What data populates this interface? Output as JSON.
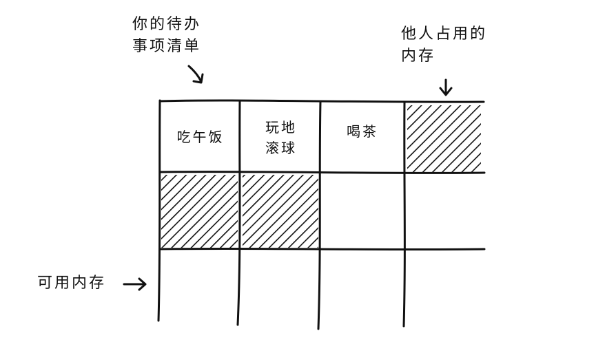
{
  "annotations": {
    "todo_list": {
      "line1": "你的待办",
      "line2": "事项清单"
    },
    "others_memory": {
      "line1": "他人占用的",
      "line2": "内存"
    },
    "available_memory": "可用内存"
  },
  "cells": {
    "lunch": "吃午饭",
    "frisbee": {
      "line1": "玩地",
      "line2": "滚球"
    },
    "tea": "喝茶"
  },
  "grid": {
    "rows": 3,
    "cols": 4,
    "hatched": [
      [
        0,
        3
      ],
      [
        1,
        0
      ],
      [
        1,
        1
      ]
    ]
  },
  "colors": {
    "ink": "#111111",
    "background": "#ffffff"
  }
}
